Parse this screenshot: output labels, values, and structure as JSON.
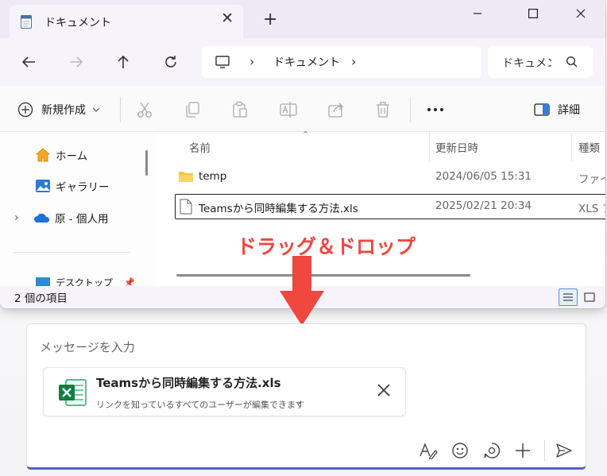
{
  "explorer": {
    "tab": {
      "title": "ドキュメント"
    },
    "address": {
      "location": "ドキュメント"
    },
    "search": {
      "placeholder": "ドキュメン"
    },
    "toolbar": {
      "new_label": "新規作成",
      "details_label": "詳細"
    },
    "nav": {
      "items": [
        {
          "label": "ホーム",
          "icon": "home-icon"
        },
        {
          "label": "ギャラリー",
          "icon": "gallery-icon"
        },
        {
          "label": "原 - 個人用",
          "icon": "onedrive-cloud-icon"
        },
        {
          "label": "デスクトップ",
          "icon": "desktop-folder-icon"
        }
      ]
    },
    "columns": {
      "name": "名前",
      "modified": "更新日時",
      "type": "種類"
    },
    "files": [
      {
        "name": "temp",
        "modified": "2024/06/05 15:31",
        "type": "ファイル",
        "icon": "folder-icon"
      },
      {
        "name": "Teamsから同時編集する方法.xls",
        "modified": "2025/02/21 20:34",
        "type": "XLS フ",
        "icon": "document-icon"
      }
    ],
    "status": "2 個の項目"
  },
  "annotation": {
    "text": "ドラッグ＆ドロップ",
    "color": "#f0473e"
  },
  "compose": {
    "placeholder": "メッセージを入力",
    "attachment": {
      "name": "Teamsから同時編集する方法.xls",
      "permission": "リンクを知っているすべてのユーザーが編集できます",
      "icon": "excel-icon"
    },
    "accent": "#5b5fc7"
  }
}
